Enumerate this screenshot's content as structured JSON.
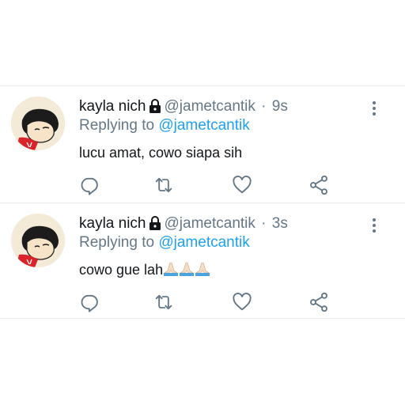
{
  "tweets": [
    {
      "display_name": "kayla nich",
      "handle": "@jametcantik",
      "separator": "·",
      "time": "9s",
      "replying_prefix": "Replying to",
      "replying_to": "@jametcantik",
      "text": "lucu amat, cowo siapa sih",
      "emoji_count": 0
    },
    {
      "display_name": "kayla nich",
      "handle": "@jametcantik",
      "separator": "·",
      "time": "3s",
      "replying_prefix": "Replying to",
      "replying_to": "@jametcantik",
      "text": "cowo gue lah",
      "emoji_count": 3
    }
  ],
  "icons": {
    "lock": "lock-icon",
    "more": "more-vertical-icon",
    "reply": "reply-icon",
    "retweet": "retweet-icon",
    "like": "heart-icon",
    "share": "share-icon",
    "emoji": "folded-hands-emoji"
  },
  "colors": {
    "text": "#14171a",
    "muted": "#657786",
    "accent": "#1da1f2",
    "divider": "#e6ecf0"
  }
}
